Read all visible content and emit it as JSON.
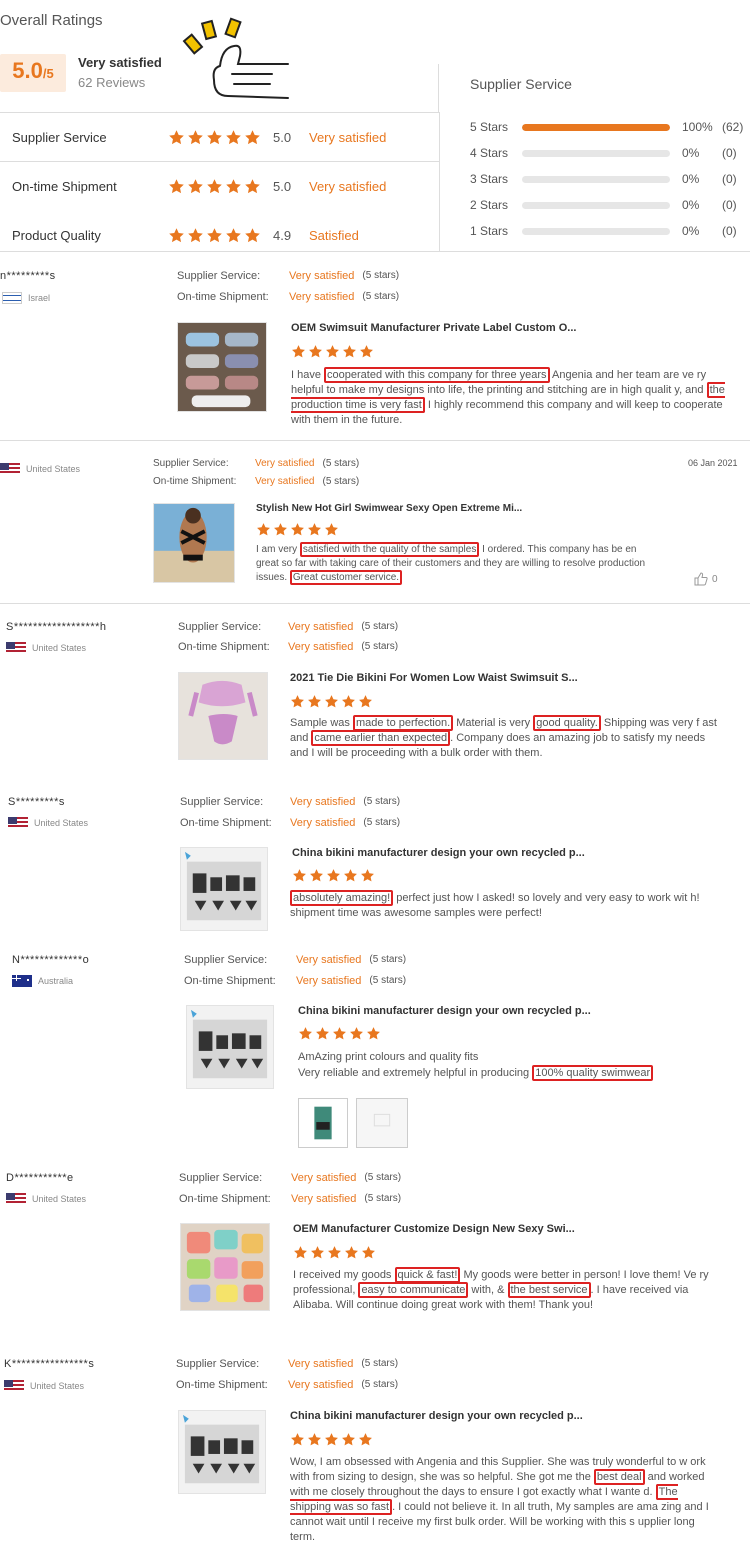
{
  "header": {
    "title": "Overall Ratings",
    "score": "5.0",
    "score_max": "/5",
    "summary": "Very satisfied",
    "reviews": "62 Reviews"
  },
  "ratings": [
    {
      "label": "Supplier Service",
      "value": "5.0",
      "text": "Very satisfied",
      "stars": 5
    },
    {
      "label": "On-time Shipment",
      "value": "5.0",
      "text": "Very satisfied",
      "stars": 5
    },
    {
      "label": "Product Quality",
      "value": "4.9",
      "text": "Satisfied",
      "stars": 5
    }
  ],
  "supplier_service": {
    "title": "Supplier Service",
    "bars": [
      {
        "label": "5 Stars",
        "percent": 100,
        "pct_text": "100%",
        "count": "(62)"
      },
      {
        "label": "4 Stars",
        "percent": 0,
        "pct_text": "0%",
        "count": "(0)"
      },
      {
        "label": "3 Stars",
        "percent": 0,
        "pct_text": "0%",
        "count": "(0)"
      },
      {
        "label": "2 Stars",
        "percent": 0,
        "pct_text": "0%",
        "count": "(0)"
      },
      {
        "label": "1 Stars",
        "percent": 0,
        "pct_text": "0%",
        "count": "(0)"
      }
    ]
  },
  "labels": {
    "supplier_service": "Supplier Service:",
    "ontime": "On-time Shipment:",
    "very_satisfied": "Very satisfied",
    "five_stars": "(5 stars)"
  },
  "reviews": [
    {
      "user": "n*********s",
      "country": "Israel",
      "product": "OEM Swimsuit Manufacturer Private Label Custom O...",
      "text_parts": [
        "I have ",
        "cooperated with this company for three years",
        " Angenia and her team are ve ry helpful to make my designs into life, the printing and stitching are in high qualit y, and ",
        "the production time is very fast",
        " I highly recommend this company and will keep to cooperate with them in the future."
      ]
    },
    {
      "user": "",
      "country": "United States",
      "date": "06 Jan 2021",
      "likes": "0",
      "product": "Stylish New Hot Girl Swimwear Sexy Open Extreme Mi...",
      "text_parts": [
        "I am very ",
        "satisfied with the quality of the samples",
        " I ordered. This company has be en great so far with taking care of their customers and they are willing to resolve production issues. ",
        "Great customer service.",
        ""
      ]
    },
    {
      "user": "S******************h",
      "country": "United States",
      "product": "2021 Tie Die Bikini For Women Low Waist Swimsuit S...",
      "text_parts": [
        "Sample was ",
        "made to perfection.",
        " Material is very ",
        "good quality.",
        " Shipping was very f ast and ",
        "came earlier than expected",
        ". Company does an amazing job to satisfy my needs and I will be proceeding with a bulk order with them."
      ]
    },
    {
      "user": "S*********s",
      "country": "United States",
      "product": "China bikini manufacturer design your own recycled p...",
      "text_parts": [
        "",
        "absolutely amazing!",
        " perfect just how I asked! so lovely and very easy to work wit h! shipment time was awesome samples were perfect!"
      ]
    },
    {
      "user": "N*************o",
      "country": "Australia",
      "product": "China bikini manufacturer design your own recycled p...",
      "line1": "AmAzing print colours and quality fits",
      "text_parts": [
        "Very reliable and extremely helpful in producing ",
        "100% quality swimwear",
        ""
      ]
    },
    {
      "user": "D***********e",
      "country": "United States",
      "product": "OEM Manufacturer Customize Design New Sexy Swi...",
      "text_parts": [
        "I received my goods ",
        "quick & fast!",
        " My goods were better in person! I love them! Ve ry professional, ",
        "easy to communicate",
        " with, & ",
        "the best service",
        ". I have received via Alibaba. Will continue doing great work with them! Thank you!"
      ]
    },
    {
      "user": "K****************s",
      "country": "United States",
      "product": "China bikini manufacturer design your own recycled p...",
      "text_parts": [
        "Wow, I am obsessed with Angenia and this Supplier. She was truly wonderful to w ork with from sizing to design, she was so helpful. She got me the ",
        "best deal",
        " and worked with me closely throughout the days to ensure I got exactly what I wante d. ",
        "The shipping was so fast",
        ". I could not believe it. In all truth, My samples are ama zing and I cannot wait until I receive my first bulk order. Will be working with this s upplier long term."
      ]
    }
  ],
  "colors": {
    "accent": "#e8771f",
    "highlight": "#dd2222",
    "score_bg": "#fcebdd"
  },
  "icons": [
    "star-icon",
    "thumbs-up-icon",
    "flag-icon"
  ]
}
